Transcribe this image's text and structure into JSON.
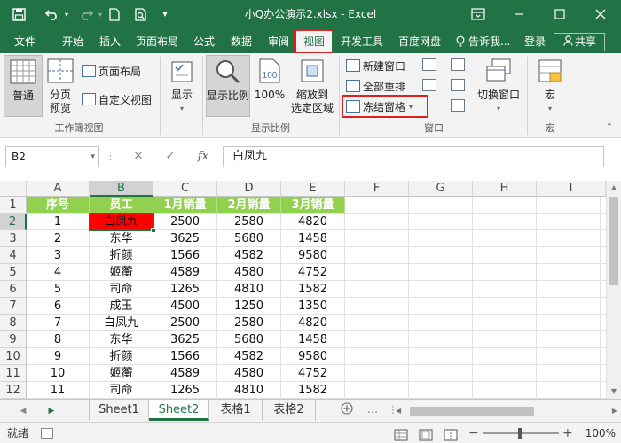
{
  "window": {
    "title": "小Q办公演示2.xlsx  -  Excel"
  },
  "icons": {
    "save": "save-icon",
    "undo": "undo-icon",
    "redo": "redo-icon",
    "new": "new-file-icon",
    "print_preview": "print-preview-icon",
    "customize": "customize-qat-icon",
    "ribbon_display": "ribbon-display-icon",
    "minimize": "minimize-icon",
    "maximize": "maximize-icon",
    "close": "close-icon"
  },
  "ribbon_tabs": [
    {
      "label": "文件"
    },
    {
      "label": "开始"
    },
    {
      "label": "插入"
    },
    {
      "label": "页面布局"
    },
    {
      "label": "公式"
    },
    {
      "label": "数据"
    },
    {
      "label": "审阅"
    },
    {
      "label": "视图"
    },
    {
      "label": "开发工具"
    },
    {
      "label": "百度网盘"
    },
    {
      "label": "告诉我..."
    },
    {
      "label": "登录"
    },
    {
      "label": "共享"
    }
  ],
  "ribbon": {
    "normal": "普通",
    "page_break": [
      "分页",
      "预览"
    ],
    "page_layout": "页面布局",
    "custom_views": "自定义视图",
    "show": "显示",
    "zoom": "显示比例",
    "zoom100": "100%",
    "zoom_selection": [
      "缩放到",
      "选定区域"
    ],
    "new_window": "新建窗口",
    "arrange_all": "全部重排",
    "freeze_panes": "冻结窗格",
    "switch_windows": "切换窗口",
    "macros": "宏",
    "group_workbook_views": "工作簿视图",
    "group_zoom": "显示比例",
    "group_window": "窗口",
    "group_macros": "宏"
  },
  "formula_bar": {
    "name_box": "B2",
    "cancel": "✕",
    "enter": "✓",
    "fx": "fx",
    "value": "白凤九"
  },
  "columns": [
    "A",
    "B",
    "C",
    "D",
    "E",
    "F",
    "G",
    "H",
    "I"
  ],
  "rows": [
    "1",
    "2",
    "3",
    "4",
    "5",
    "6",
    "7",
    "8",
    "9",
    "10",
    "11",
    "12"
  ],
  "table": {
    "headers": [
      "序号",
      "员工",
      "1月销量",
      "2月销量",
      "3月销量"
    ],
    "rows": [
      [
        "1",
        "白凤九",
        "2500",
        "2580",
        "4820"
      ],
      [
        "2",
        "东华",
        "3625",
        "5680",
        "1458"
      ],
      [
        "3",
        "折颜",
        "1566",
        "4582",
        "9580"
      ],
      [
        "4",
        "姬蘅",
        "4589",
        "4580",
        "4752"
      ],
      [
        "5",
        "司命",
        "1265",
        "4810",
        "1582"
      ],
      [
        "6",
        "成玉",
        "4500",
        "1250",
        "1350"
      ],
      [
        "7",
        "白凤九",
        "2500",
        "2580",
        "4820"
      ],
      [
        "8",
        "东华",
        "3625",
        "5680",
        "1458"
      ],
      [
        "9",
        "折颜",
        "1566",
        "4582",
        "9580"
      ],
      [
        "10",
        "姬蘅",
        "4589",
        "4580",
        "4752"
      ],
      [
        "11",
        "司命",
        "1265",
        "4810",
        "1582"
      ]
    ]
  },
  "sheets": [
    {
      "label": "Sheet1"
    },
    {
      "label": "Sheet2"
    },
    {
      "label": "表格1"
    },
    {
      "label": "表格2"
    }
  ],
  "sheet_more": "...",
  "status": {
    "ready": "就绪",
    "zoom": "100%"
  },
  "colors": {
    "excel_green": "#217346",
    "header_fill": "#92d050",
    "highlight_red": "#ff0000",
    "annotation_red": "#e02020"
  }
}
